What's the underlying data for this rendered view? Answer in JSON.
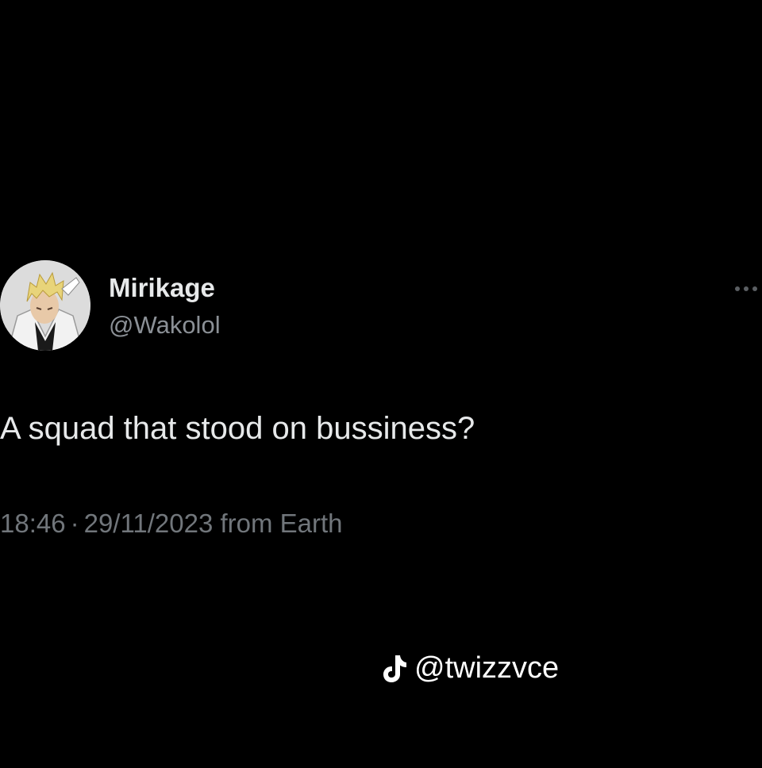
{
  "tweet": {
    "display_name": "Mirikage",
    "handle": "@Wakolol",
    "text": "A squad that stood on bussiness?",
    "time": "18:46",
    "separator": "·",
    "date": "29/11/2023",
    "source": "from Earth"
  },
  "watermark": {
    "icon": "tiktok-icon",
    "handle": "@twizzvce"
  },
  "colors": {
    "background": "#000000",
    "primary_text": "#e7e9ea",
    "secondary_text": "#71767b"
  }
}
